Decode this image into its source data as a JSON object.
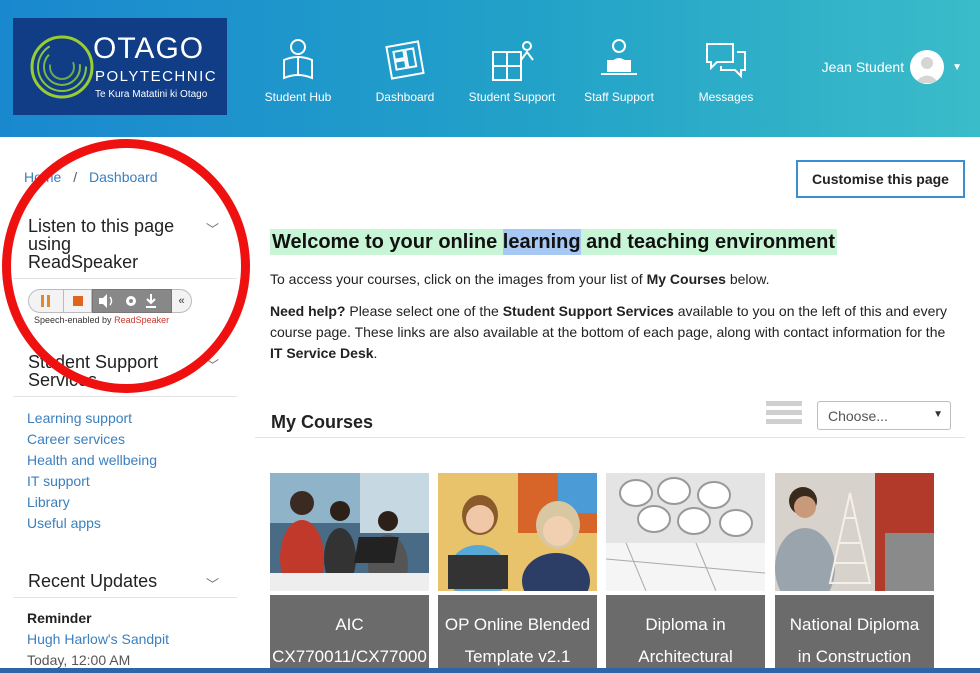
{
  "header": {
    "logo": {
      "name": "OTAGO",
      "subtitle": "POLYTECHNIC",
      "maori": "Te Kura Matatini ki Otago"
    },
    "nav": [
      {
        "label": "Student Hub",
        "icon": "student-reading-icon"
      },
      {
        "label": "Dashboard",
        "icon": "dashboard-icon"
      },
      {
        "label": "Student Support",
        "icon": "puzzle-people-icon"
      },
      {
        "label": "Staff Support",
        "icon": "staff-desk-icon"
      },
      {
        "label": "Messages",
        "icon": "chat-bubbles-icon"
      }
    ],
    "user": {
      "name": "Jean Student"
    }
  },
  "breadcrumb": {
    "home": "Home",
    "separator": "/",
    "current": "Dashboard"
  },
  "readspeaker": {
    "title_line1": "Listen to this page",
    "title_line2": "using",
    "title_line3": "ReadSpeaker",
    "label_prefix": "Speech-enabled by",
    "label_brand": "ReadSpeaker"
  },
  "support": {
    "title_line1": "Student Support",
    "title_line2": "Services",
    "links": [
      "Learning support",
      "Career services",
      "Health and wellbeing",
      "IT support",
      "Library",
      "Useful apps"
    ]
  },
  "recent": {
    "title": "Recent Updates",
    "reminder": "Reminder",
    "link": "Hugh Harlow's Sandpit",
    "time": "Today, 12:00 AM"
  },
  "main": {
    "customise": "Customise this page",
    "welcome_a": "Welcome to your online ",
    "welcome_b": "learning",
    "welcome_c": " and teaching environment",
    "intro_a": "To access your courses, click on the images from your list of ",
    "intro_b": "My Courses",
    "intro_c": " below.",
    "help_a": "Need help?",
    "help_b": " Please select one of the ",
    "help_c": "Student Support Services",
    "help_d": " available to you on the left of this and every course page. These links are also available at the bottom of each page, along with contact information for the ",
    "help_e": "IT Service Desk",
    "help_f": ".",
    "mycourses": "My Courses",
    "choose": "Choose...",
    "courses": [
      {
        "line1": "AIC",
        "line2": "CX770011/CX77000"
      },
      {
        "line1": "OP Online Blended",
        "line2": "Template v2.1"
      },
      {
        "line1": "Diploma in",
        "line2": "Architectural"
      },
      {
        "line1": "National Diploma",
        "line2": "in Construction"
      }
    ]
  },
  "colors": {
    "header_start": "#1a88cf",
    "header_end": "#3bbcc9",
    "logo_bg": "#103d86",
    "link": "#3a7fc0",
    "annotation": "#ef1010"
  }
}
